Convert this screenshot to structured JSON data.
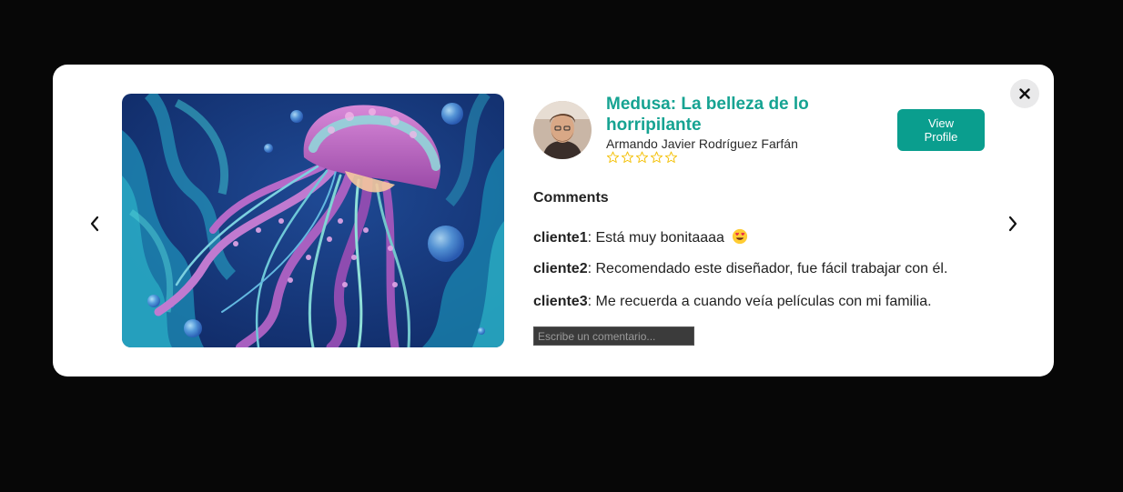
{
  "post": {
    "title": "Medusa: La belleza de lo horripilante",
    "author": "Armando Javier Rodríguez Farfán",
    "rating": 0,
    "rating_max": 5,
    "view_profile_label": "View Profile"
  },
  "comments": {
    "heading": "Comments",
    "items": [
      {
        "user": "cliente1",
        "text": "Está muy bonitaaaa",
        "emoji": "smiling-face-with-heart-eyes"
      },
      {
        "user": "cliente2",
        "text": "Recomendado este diseñador, fue fácil trabajar con él."
      },
      {
        "user": "cliente3",
        "text": "Me recuerda a cuando veía películas con mi familia."
      }
    ],
    "input_placeholder": "Escribe un comentario...",
    "input_value": ""
  },
  "icons": {
    "close": "close-icon",
    "prev": "chevron-left-icon",
    "next": "chevron-right-icon",
    "star": "star-outline-icon"
  },
  "colors": {
    "backdrop": "#070707",
    "modal": "#ffffff",
    "accent": "#0a9e8e",
    "title": "#16a392",
    "star": "#f4c20d",
    "input_bg": "#3b3b3b"
  }
}
